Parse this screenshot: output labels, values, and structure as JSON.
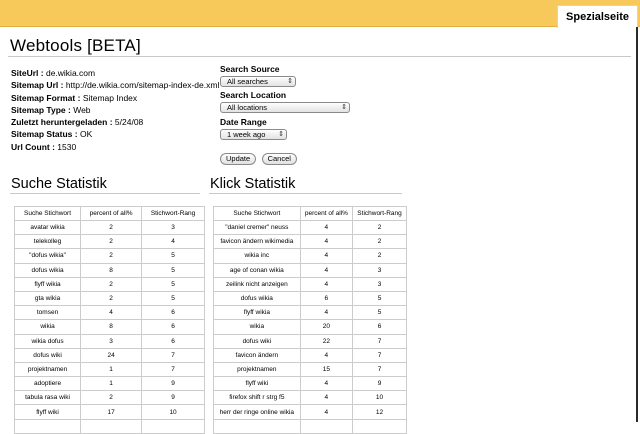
{
  "top": {
    "tab_label": "Spezialseite"
  },
  "page": {
    "title": "Webtools [BETA]"
  },
  "info": [
    {
      "label": "SiteUrl :",
      "value": "de.wikia.com"
    },
    {
      "label": "Sitemap Url :",
      "value": "http://de.wikia.com/sitemap-index-de.xml"
    },
    {
      "label": "Sitemap Format :",
      "value": "Sitemap Index"
    },
    {
      "label": "Sitemap Type :",
      "value": "Web"
    },
    {
      "label": "Zuletzt heruntergeladen :",
      "value": "5/24/08"
    },
    {
      "label": "Sitemap Status :",
      "value": "OK"
    },
    {
      "label": "Url Count :",
      "value": "1530"
    }
  ],
  "form": {
    "source_label": "Search Source",
    "source_value": "All searches",
    "location_label": "Search Location",
    "location_value": "All locations",
    "range_label": "Date Range",
    "range_value": "1 week ago",
    "update_label": "Update",
    "cancel_label": "Cancel"
  },
  "suche": {
    "title": "Suche Statistik",
    "headers": [
      "Suche Stichwort",
      "percent of all%",
      "Stichwort-Rang"
    ],
    "rows": [
      [
        "avatar wikia",
        "2",
        "3"
      ],
      [
        "telekolleg",
        "2",
        "4"
      ],
      [
        "\"dofus wikia\"",
        "2",
        "5"
      ],
      [
        "dofus wikia",
        "8",
        "5"
      ],
      [
        "flyff wikia",
        "2",
        "5"
      ],
      [
        "gta wikia",
        "2",
        "5"
      ],
      [
        "tomsen",
        "4",
        "6"
      ],
      [
        "wikia",
        "8",
        "6"
      ],
      [
        "wikia dofus",
        "3",
        "6"
      ],
      [
        "dofus wiki",
        "24",
        "7"
      ],
      [
        "projektnamen",
        "1",
        "7"
      ],
      [
        "adoptiere",
        "1",
        "9"
      ],
      [
        "tabula rasa wiki",
        "2",
        "9"
      ],
      [
        "flyff wiki",
        "17",
        "10"
      ],
      [
        "",
        "",
        ""
      ]
    ]
  },
  "klick": {
    "title": "Klick Statistik",
    "headers": [
      "Suche Stichwort",
      "percent of all%",
      "Stichwort-Rang"
    ],
    "rows": [
      [
        "\"daniel cremer\" neuss",
        "4",
        "2"
      ],
      [
        "favicon ändern wikimedia",
        "4",
        "2"
      ],
      [
        "wikia inc",
        "4",
        "2"
      ],
      [
        "age of conan wikia",
        "4",
        "3"
      ],
      [
        "zeilink nicht anzeigen",
        "4",
        "3"
      ],
      [
        "dofus wikia",
        "6",
        "5"
      ],
      [
        "flyff wikia",
        "4",
        "5"
      ],
      [
        "wikia",
        "20",
        "6"
      ],
      [
        "dofus wiki",
        "22",
        "7"
      ],
      [
        "favicon ändern",
        "4",
        "7"
      ],
      [
        "projektnamen",
        "15",
        "7"
      ],
      [
        "flyff wiki",
        "4",
        "9"
      ],
      [
        "firefox shift r strg f5",
        "4",
        "10"
      ],
      [
        "herr der ringe online wikia",
        "4",
        "12"
      ],
      [
        "",
        "",
        ""
      ]
    ]
  }
}
